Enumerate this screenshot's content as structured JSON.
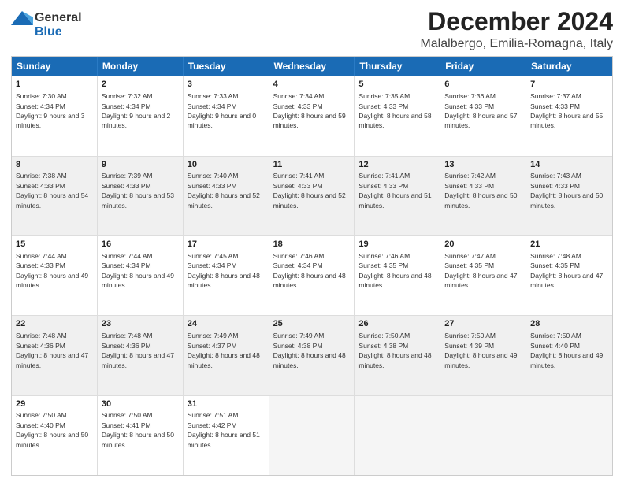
{
  "logo": {
    "line1": "General",
    "line2": "Blue"
  },
  "title": "December 2024",
  "subtitle": "Malalbergo, Emilia-Romagna, Italy",
  "days": [
    "Sunday",
    "Monday",
    "Tuesday",
    "Wednesday",
    "Thursday",
    "Friday",
    "Saturday"
  ],
  "weeks": [
    [
      {
        "day": "1",
        "sunrise": "7:30 AM",
        "sunset": "4:34 PM",
        "daylight": "9 hours and 3 minutes."
      },
      {
        "day": "2",
        "sunrise": "7:32 AM",
        "sunset": "4:34 PM",
        "daylight": "9 hours and 2 minutes."
      },
      {
        "day": "3",
        "sunrise": "7:33 AM",
        "sunset": "4:34 PM",
        "daylight": "9 hours and 0 minutes."
      },
      {
        "day": "4",
        "sunrise": "7:34 AM",
        "sunset": "4:33 PM",
        "daylight": "8 hours and 59 minutes."
      },
      {
        "day": "5",
        "sunrise": "7:35 AM",
        "sunset": "4:33 PM",
        "daylight": "8 hours and 58 minutes."
      },
      {
        "day": "6",
        "sunrise": "7:36 AM",
        "sunset": "4:33 PM",
        "daylight": "8 hours and 57 minutes."
      },
      {
        "day": "7",
        "sunrise": "7:37 AM",
        "sunset": "4:33 PM",
        "daylight": "8 hours and 55 minutes."
      }
    ],
    [
      {
        "day": "8",
        "sunrise": "7:38 AM",
        "sunset": "4:33 PM",
        "daylight": "8 hours and 54 minutes."
      },
      {
        "day": "9",
        "sunrise": "7:39 AM",
        "sunset": "4:33 PM",
        "daylight": "8 hours and 53 minutes."
      },
      {
        "day": "10",
        "sunrise": "7:40 AM",
        "sunset": "4:33 PM",
        "daylight": "8 hours and 52 minutes."
      },
      {
        "day": "11",
        "sunrise": "7:41 AM",
        "sunset": "4:33 PM",
        "daylight": "8 hours and 52 minutes."
      },
      {
        "day": "12",
        "sunrise": "7:41 AM",
        "sunset": "4:33 PM",
        "daylight": "8 hours and 51 minutes."
      },
      {
        "day": "13",
        "sunrise": "7:42 AM",
        "sunset": "4:33 PM",
        "daylight": "8 hours and 50 minutes."
      },
      {
        "day": "14",
        "sunrise": "7:43 AM",
        "sunset": "4:33 PM",
        "daylight": "8 hours and 50 minutes."
      }
    ],
    [
      {
        "day": "15",
        "sunrise": "7:44 AM",
        "sunset": "4:33 PM",
        "daylight": "8 hours and 49 minutes."
      },
      {
        "day": "16",
        "sunrise": "7:44 AM",
        "sunset": "4:34 PM",
        "daylight": "8 hours and 49 minutes."
      },
      {
        "day": "17",
        "sunrise": "7:45 AM",
        "sunset": "4:34 PM",
        "daylight": "8 hours and 48 minutes."
      },
      {
        "day": "18",
        "sunrise": "7:46 AM",
        "sunset": "4:34 PM",
        "daylight": "8 hours and 48 minutes."
      },
      {
        "day": "19",
        "sunrise": "7:46 AM",
        "sunset": "4:35 PM",
        "daylight": "8 hours and 48 minutes."
      },
      {
        "day": "20",
        "sunrise": "7:47 AM",
        "sunset": "4:35 PM",
        "daylight": "8 hours and 47 minutes."
      },
      {
        "day": "21",
        "sunrise": "7:48 AM",
        "sunset": "4:35 PM",
        "daylight": "8 hours and 47 minutes."
      }
    ],
    [
      {
        "day": "22",
        "sunrise": "7:48 AM",
        "sunset": "4:36 PM",
        "daylight": "8 hours and 47 minutes."
      },
      {
        "day": "23",
        "sunrise": "7:48 AM",
        "sunset": "4:36 PM",
        "daylight": "8 hours and 47 minutes."
      },
      {
        "day": "24",
        "sunrise": "7:49 AM",
        "sunset": "4:37 PM",
        "daylight": "8 hours and 48 minutes."
      },
      {
        "day": "25",
        "sunrise": "7:49 AM",
        "sunset": "4:38 PM",
        "daylight": "8 hours and 48 minutes."
      },
      {
        "day": "26",
        "sunrise": "7:50 AM",
        "sunset": "4:38 PM",
        "daylight": "8 hours and 48 minutes."
      },
      {
        "day": "27",
        "sunrise": "7:50 AM",
        "sunset": "4:39 PM",
        "daylight": "8 hours and 49 minutes."
      },
      {
        "day": "28",
        "sunrise": "7:50 AM",
        "sunset": "4:40 PM",
        "daylight": "8 hours and 49 minutes."
      }
    ],
    [
      {
        "day": "29",
        "sunrise": "7:50 AM",
        "sunset": "4:40 PM",
        "daylight": "8 hours and 50 minutes."
      },
      {
        "day": "30",
        "sunrise": "7:50 AM",
        "sunset": "4:41 PM",
        "daylight": "8 hours and 50 minutes."
      },
      {
        "day": "31",
        "sunrise": "7:51 AM",
        "sunset": "4:42 PM",
        "daylight": "8 hours and 51 minutes."
      },
      null,
      null,
      null,
      null
    ]
  ]
}
